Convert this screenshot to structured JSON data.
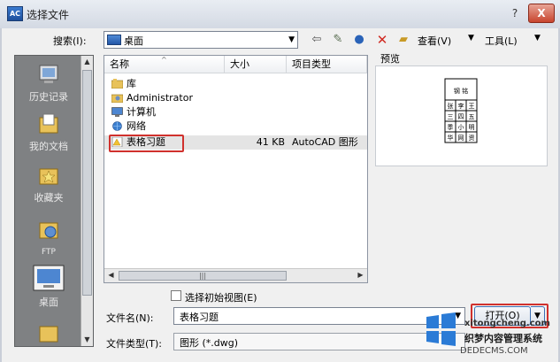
{
  "window": {
    "title": "选择文件",
    "app_icon": "AC",
    "help": "?",
    "close": "X"
  },
  "toolbar": {
    "lookin_label": "搜索(I):",
    "lookin_value": "桌面",
    "view_label": "查看(V)",
    "tools_label": "工具(L)"
  },
  "places": [
    {
      "label": "历史记录",
      "icon": "history-icon"
    },
    {
      "label": "我的文档",
      "icon": "documents-icon"
    },
    {
      "label": "收藏夹",
      "icon": "favorites-icon"
    },
    {
      "label": "FTP",
      "icon": "ftp-icon"
    },
    {
      "label": "桌面",
      "icon": "desktop-icon"
    }
  ],
  "filelist": {
    "columns": [
      "名称",
      "大小",
      "项目类型"
    ],
    "rows": [
      {
        "name": "库",
        "size": "",
        "type": "",
        "icon": "library-icon"
      },
      {
        "name": "Administrator",
        "size": "",
        "type": "",
        "icon": "user-folder-icon"
      },
      {
        "name": "计算机",
        "size": "",
        "type": "",
        "icon": "computer-icon"
      },
      {
        "name": "网络",
        "size": "",
        "type": "",
        "icon": "network-icon"
      },
      {
        "name": "表格习题",
        "size": "41 KB",
        "type": "AutoCAD 图形",
        "icon": "dwg-file-icon",
        "selected": true
      }
    ]
  },
  "preview": {
    "label": "预览",
    "title": "钢 铭",
    "cells": [
      "张",
      "李",
      "王",
      "三",
      "四",
      "五",
      "季",
      "小",
      "明",
      "华",
      "网",
      "资"
    ]
  },
  "bottom": {
    "initial_view_label": "选择初始视图(E)",
    "filename_label": "文件名(N):",
    "filename_value": "表格习题",
    "filetype_label": "文件类型(T):",
    "filetype_value": "图形 (*.dwg)",
    "open_label": "打开(O)"
  },
  "watermark": {
    "line1": "xitongcheng.com",
    "line2": "织梦内容管理系统",
    "line3": "DEDECMS.COM"
  },
  "colors": {
    "highlight": "#d0312d",
    "accent": "#3c6fb4"
  }
}
